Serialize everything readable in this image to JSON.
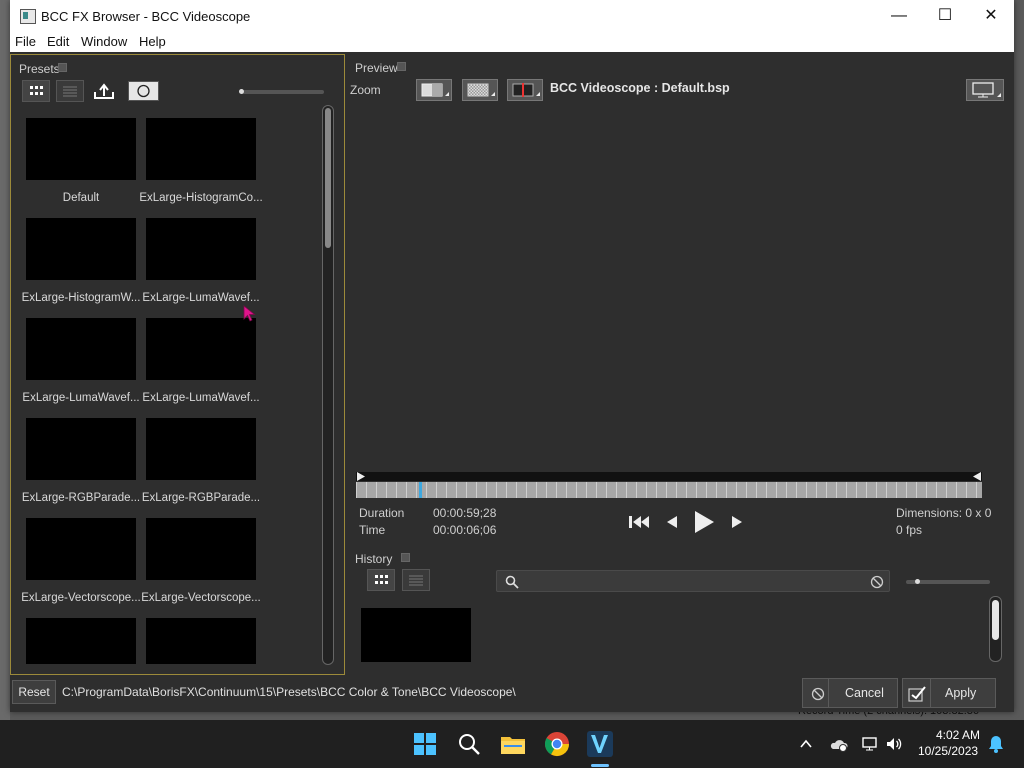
{
  "window": {
    "title": "BCC FX Browser - BCC Videoscope",
    "minimize": "—",
    "maximize": "☐",
    "close": "✕"
  },
  "menu": [
    "File",
    "Edit",
    "Window",
    "Help"
  ],
  "presets": {
    "title": "Presets",
    "items": [
      "Default",
      "ExLarge-HistogramCo...",
      "ExLarge-HistogramW...",
      "ExLarge-LumaWavef...",
      "ExLarge-LumaWavef...",
      "ExLarge-LumaWavef...",
      "ExLarge-RGBParade...",
      "ExLarge-RGBParade...",
      "ExLarge-Vectorscope...",
      "ExLarge-Vectorscope..."
    ]
  },
  "preview": {
    "title": "Preview",
    "zoom_label": "Zoom",
    "file": "BCC Videoscope : Default.bsp",
    "duration_label": "Duration",
    "duration": "00:00:59;28",
    "time_label": "Time",
    "time": "00:00:06;06",
    "dimensions": "Dimensions: 0 x 0",
    "fps": "0 fps"
  },
  "history": {
    "title": "History"
  },
  "bottom": {
    "reset": "Reset",
    "path": "C:\\ProgramData\\BorisFX\\Continuum\\15\\Presets\\BCC Color & Tone\\BCC Videoscope\\",
    "cancel": "Cancel",
    "apply": "Apply"
  },
  "background": {
    "status": "Record Time (2 channels): 103:32:36"
  },
  "taskbar": {
    "time": "4:02 AM",
    "date": "10/25/2023"
  },
  "colors": {
    "accent": "#9c8a3a",
    "panel": "#2e2e2e",
    "taskbar": "#202020"
  }
}
